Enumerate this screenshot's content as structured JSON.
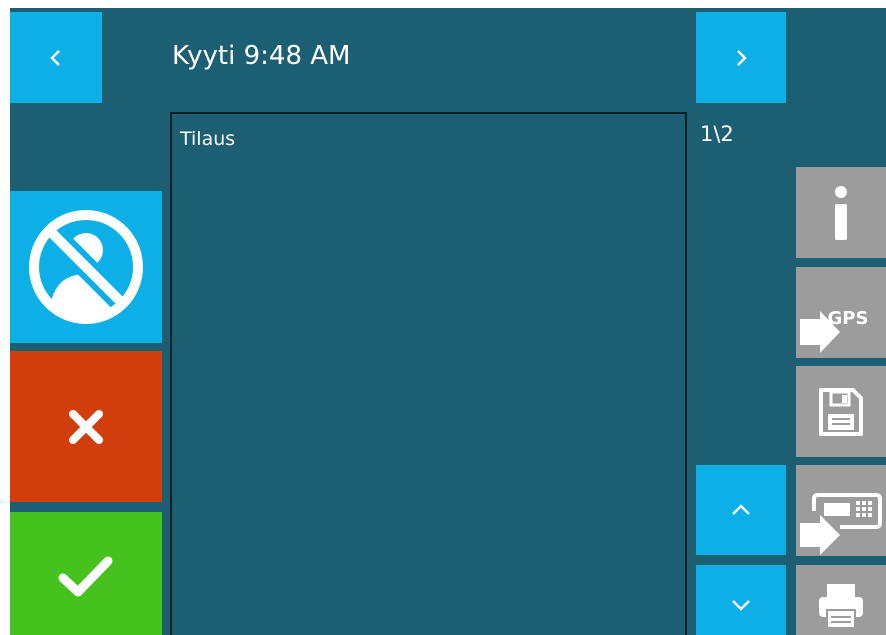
{
  "header": {
    "title": "Kyyti 9:48 AM",
    "page_indicator": "1\\2",
    "prev_icon": "chevron-left-icon",
    "next_icon": "chevron-right-icon"
  },
  "order_panel": {
    "header": "Tilaus"
  },
  "left_actions": [
    {
      "name": "no-passenger-button",
      "icon": "no-person-icon",
      "color": "#0db0e6"
    },
    {
      "name": "cancel-button",
      "icon": "close-icon",
      "color": "#d23d0c"
    },
    {
      "name": "confirm-button",
      "icon": "checkmark-icon",
      "color": "#45c21e"
    }
  ],
  "right_tools": [
    {
      "name": "info-button",
      "icon": "info-icon"
    },
    {
      "name": "send-gps-button",
      "icon": "gps-send-icon",
      "label": "GPS"
    },
    {
      "name": "save-button",
      "icon": "floppy-disk-icon"
    },
    {
      "name": "send-to-terminal-button",
      "icon": "terminal-send-icon"
    },
    {
      "name": "print-button",
      "icon": "printer-icon"
    }
  ],
  "scroll": {
    "up_icon": "chevron-up-icon",
    "down_icon": "chevron-down-icon"
  }
}
